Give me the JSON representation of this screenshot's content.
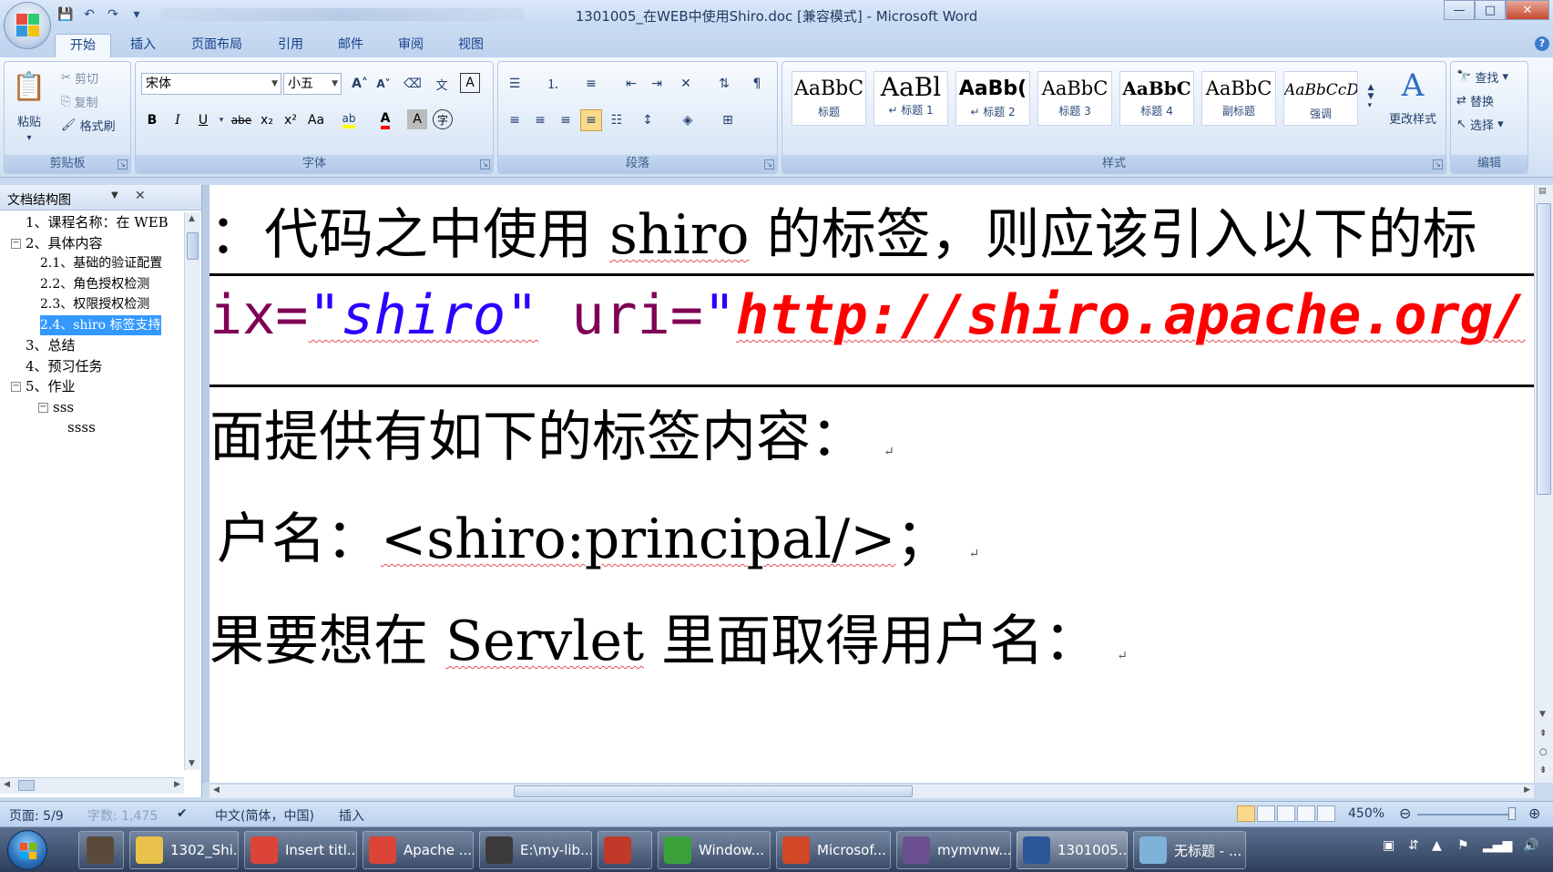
{
  "window": {
    "title": "1301005_在WEB中使用Shiro.doc [兼容模式] - Microsoft Word",
    "min": "—",
    "max": "□",
    "close": "✕"
  },
  "tabs": [
    "开始",
    "插入",
    "页面布局",
    "引用",
    "邮件",
    "审阅",
    "视图"
  ],
  "clipboard": {
    "label": "剪贴板",
    "paste": "粘贴",
    "cut": "剪切",
    "copy": "复制",
    "format_painter": "格式刷"
  },
  "font": {
    "label": "字体",
    "name": "宋体",
    "size": "小五",
    "bold": "B",
    "italic": "I",
    "underline": "U",
    "strike": "abe",
    "sub": "x₂",
    "sup": "x²",
    "case": "Aa",
    "grow": "A˄",
    "shrink": "A˅",
    "color_a": "A",
    "char_shade": "A",
    "highlight_color": "#ffff00",
    "font_color": "#ff0000"
  },
  "paragraph": {
    "label": "段落"
  },
  "styles": {
    "label": "样式",
    "items": [
      {
        "preview": "AaBbC",
        "name": "标题"
      },
      {
        "preview": "AaBl",
        "name": "↵ 标题 1"
      },
      {
        "preview": "AaBb(",
        "name": "↵ 标题 2"
      },
      {
        "preview": "AaBbC",
        "name": "标题 3"
      },
      {
        "preview": "AaBbC",
        "name": "标题 4"
      },
      {
        "preview": "AaBbC",
        "name": "副标题"
      },
      {
        "preview": "AaBbCcD",
        "name": "强调"
      }
    ],
    "change_styles": "更改样式"
  },
  "editing": {
    "label": "编辑",
    "find": "查找",
    "replace": "替换",
    "select": "选择"
  },
  "nav_pane": {
    "title": "文档结构图",
    "items": [
      {
        "text": "1、课程名称：在 WEB",
        "level": 0,
        "toggle": ""
      },
      {
        "text": "2、具体内容",
        "level": 0,
        "toggle": "−"
      },
      {
        "text": "2.1、基础的验证配置",
        "level": 1,
        "toggle": ""
      },
      {
        "text": "2.2、角色授权检测",
        "level": 1,
        "toggle": ""
      },
      {
        "text": "2.3、权限授权检测",
        "level": 1,
        "toggle": ""
      },
      {
        "text": "2.4、shiro 标签支持",
        "level": 1,
        "toggle": "",
        "selected": true
      },
      {
        "text": "3、总结",
        "level": 0,
        "toggle": ""
      },
      {
        "text": "4、预习任务",
        "level": 0,
        "toggle": ""
      },
      {
        "text": "5、作业",
        "level": 0,
        "toggle": "−"
      },
      {
        "text": "sss",
        "level": 1,
        "toggle": "−"
      },
      {
        "text": "ssss",
        "level": 2,
        "toggle": ""
      }
    ]
  },
  "document": {
    "line1": {
      "a": "：代码之中使用 ",
      "b": "shiro",
      "c": " 的标签，则应该引入以下的标"
    },
    "line2": {
      "a": "ix=",
      "b": "\"shiro\"",
      "c": " uri=",
      "d": "\"",
      "e": "http://shiro.apache.org/"
    },
    "line3": "面提供有如下的标签内容：",
    "line4": {
      "a": "户名：",
      "b": "<shiro:principal/>",
      "c": "；"
    },
    "line5": {
      "a": "果要想在 ",
      "b": "Servlet",
      "c": " 里面取得用户名："
    },
    "para_mark": "↵",
    "code_attr_color": "#7f0055",
    "code_str_color": "#2a00ff",
    "code_url_color": "#ff0000"
  },
  "status": {
    "page": "页面: 5/9",
    "words": "字数: 1,475",
    "lang": "中文(简体，中国)",
    "mode": "插入",
    "zoom": "450%"
  },
  "taskbar": {
    "items": [
      {
        "label": "1302_Shi...",
        "color": "#e9c24b"
      },
      {
        "label": "Insert titl...",
        "color": "#db4437"
      },
      {
        "label": "Apache ...",
        "color": "#db4437"
      },
      {
        "label": "E:\\my-lib...",
        "color": "#3b3b3b"
      },
      {
        "label": "",
        "color": "#c0392b"
      },
      {
        "label": "Window...",
        "color": "#3aa13a"
      },
      {
        "label": "Microsof...",
        "color": "#d24726"
      },
      {
        "label": "mymvnw...",
        "color": "#6b4f8f"
      },
      {
        "label": "1301005...",
        "color": "#2b579a"
      },
      {
        "label": "无标题 - ...",
        "color": "#7fb2d8"
      }
    ]
  }
}
